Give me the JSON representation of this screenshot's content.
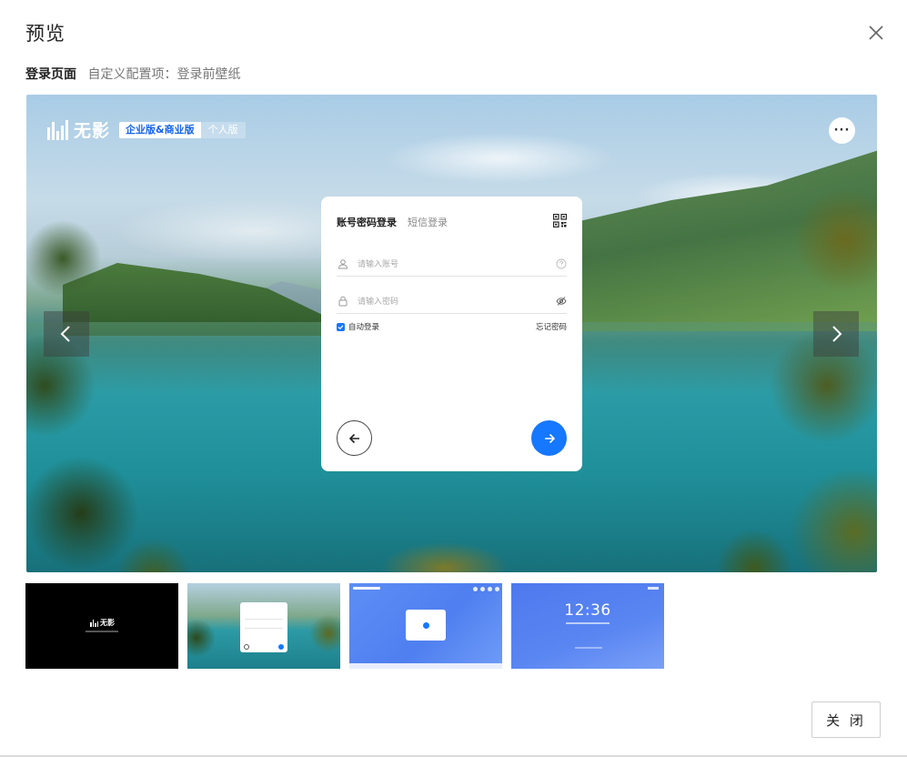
{
  "dialog": {
    "title": "预览",
    "close_label": "关 闭"
  },
  "breadcrumb": {
    "page": "登录页面",
    "detail": "自定义配置项：登录前壁纸"
  },
  "preview": {
    "brand_name": "无影",
    "edition_active": "企业版&商业版",
    "edition_inactive": "个人版",
    "more_label": "···",
    "login": {
      "tab_account": "账号密码登录",
      "tab_sms": "短信登录",
      "username_placeholder": "请输入账号",
      "password_placeholder": "请输入密码",
      "auto_login": "自动登录",
      "forgot_password": "忘记密码"
    }
  },
  "thumbnails": [
    {
      "brand": "无影"
    },
    {},
    {},
    {
      "time": "12:36"
    }
  ],
  "colors": {
    "accent": "#1677ff",
    "text_primary": "#1f1f1f",
    "text_secondary": "#777777"
  }
}
